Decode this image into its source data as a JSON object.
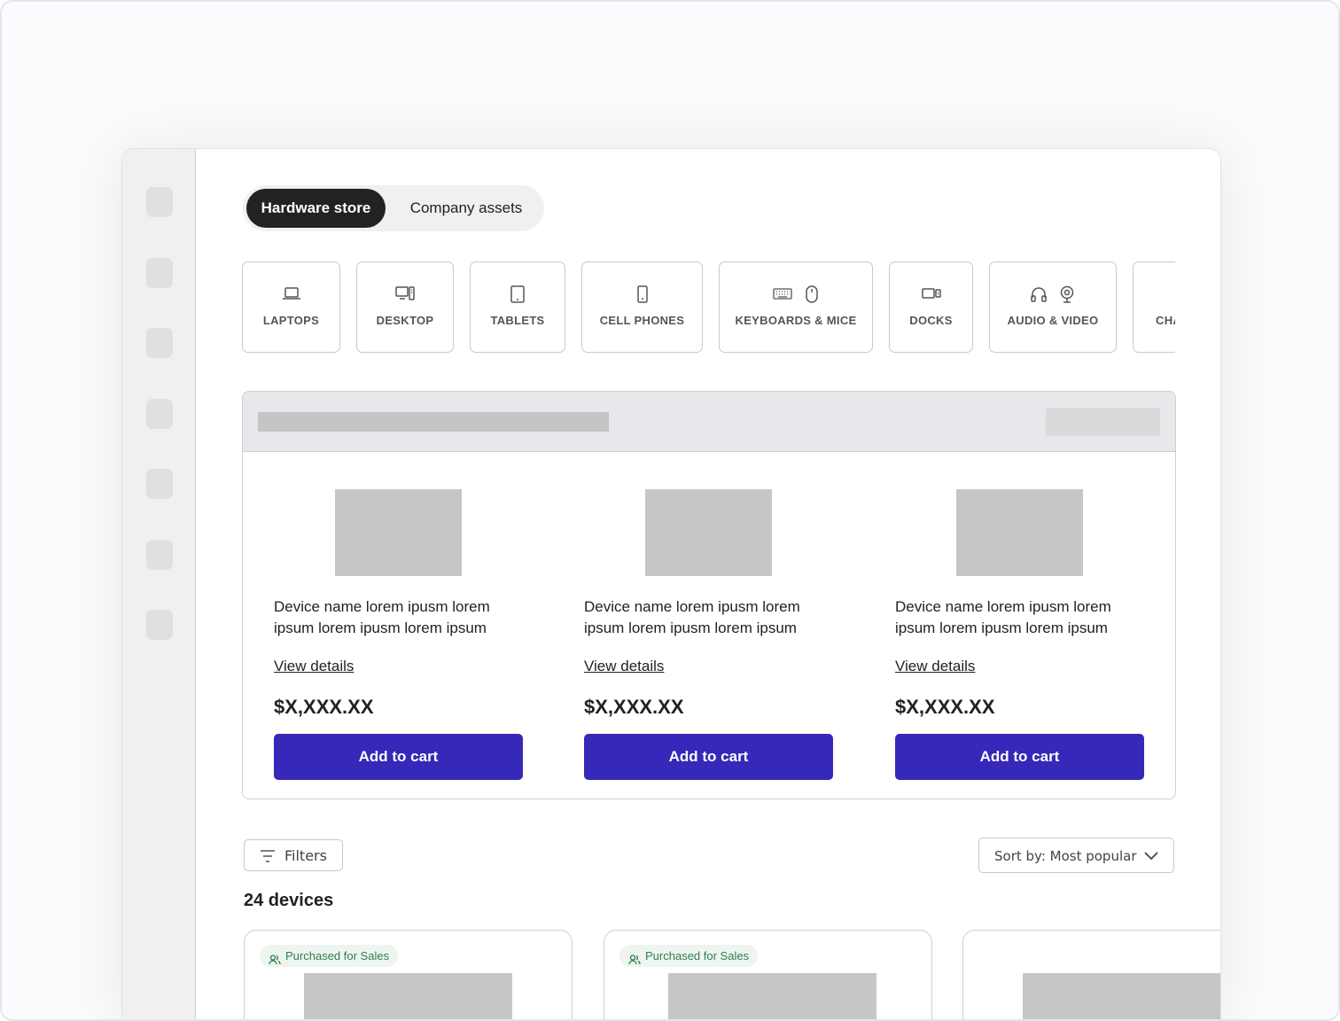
{
  "tabs": {
    "active": "Hardware store",
    "inactive": "Company assets"
  },
  "categories": [
    {
      "label": "LAPTOPS",
      "icons": [
        "laptop-icon"
      ]
    },
    {
      "label": "DESKTOP",
      "icons": [
        "desktop-icon"
      ]
    },
    {
      "label": "TABLETS",
      "icons": [
        "tablet-icon"
      ]
    },
    {
      "label": "CELL PHONES",
      "icons": [
        "cell-phone-icon"
      ]
    },
    {
      "label": "KEYBOARDS & MICE",
      "icons": [
        "keyboard-icon",
        "mouse-icon"
      ]
    },
    {
      "label": "DOCKS",
      "icons": [
        "dock-icon"
      ]
    },
    {
      "label": "AUDIO & VIDEO",
      "icons": [
        "headphones-icon",
        "webcam-icon"
      ]
    },
    {
      "label": "CHA",
      "icons": []
    }
  ],
  "featured": {
    "products": [
      {
        "name": "Device name lorem ipusm lorem\nipsum  lorem ipusm lorem ipsum",
        "link": "View details",
        "price": "$X,XXX.XX",
        "cta": "Add to cart"
      },
      {
        "name": "Device name lorem ipusm lorem\nipsum  lorem ipusm lorem ipsum",
        "link": "View details",
        "price": "$X,XXX.XX",
        "cta": "Add to cart"
      },
      {
        "name": "Device name lorem ipusm lorem\nipsum  lorem ipusm lorem ipsum",
        "link": "View details",
        "price": "$X,XXX.XX",
        "cta": "Add to cart"
      }
    ]
  },
  "toolbar": {
    "filters_label": "Filters",
    "sort_label": "Sort by: Most popular"
  },
  "device_count": "24 devices",
  "devices": [
    {
      "badge": "Purchased for Sales"
    },
    {
      "badge": "Purchased for Sales"
    },
    {
      "badge": ""
    }
  ],
  "colors": {
    "accent": "#3628b8",
    "tab_active": "#222222",
    "badge_text": "#2e7d4f",
    "badge_bg": "#eef5ef"
  }
}
